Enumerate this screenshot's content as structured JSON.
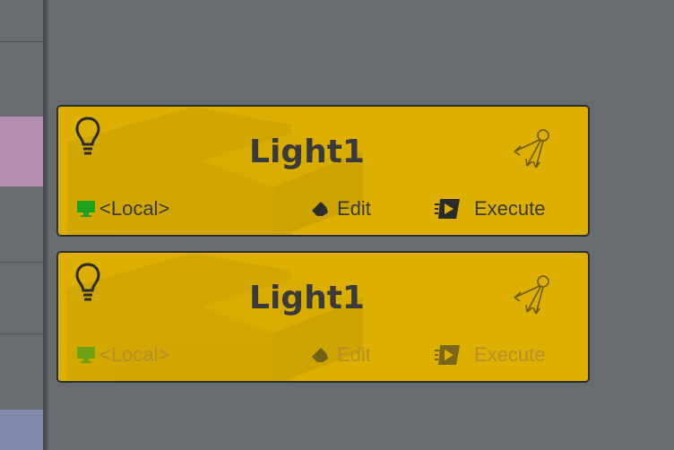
{
  "nodes": [
    {
      "title": "Light1",
      "location_label": "<Local>",
      "edit_label": "Edit",
      "execute_label": "Execute",
      "enabled": true
    },
    {
      "title": "Light1",
      "location_label": "<Local>",
      "edit_label": "Edit",
      "execute_label": "Execute",
      "enabled": false
    }
  ],
  "colors": {
    "canvas": "#686c6f",
    "node_fill": "#dcaf00",
    "node_border": "#2e2e2e",
    "text": "#3a3a3a",
    "monitor_icon": "#1fa01f",
    "strip_highlight_pink": "#b48cb4",
    "strip_highlight_blue": "#8288ae"
  },
  "icons": [
    "lightbulb-icon",
    "light-rig-icon",
    "monitor-icon",
    "pencil-icon",
    "execute-icon"
  ]
}
